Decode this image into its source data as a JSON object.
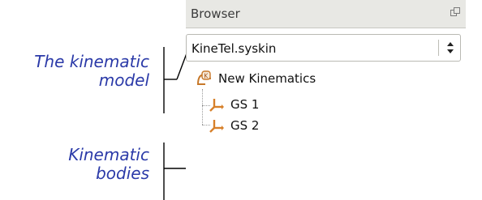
{
  "annotations": {
    "model": [
      "The kinematic",
      "model"
    ],
    "bodies": [
      "Kinematic",
      "bodies"
    ]
  },
  "panel": {
    "title": "Browser",
    "float_icon": "float-window-icon",
    "selector_value": "KineTel.syskin",
    "tree": {
      "root": {
        "label": "New Kinematics",
        "icon": "kinematics-root-icon"
      },
      "children": [
        {
          "label": "GS 1",
          "icon": "kinematic-body-icon"
        },
        {
          "label": "GS 2",
          "icon": "kinematic-body-icon"
        }
      ]
    }
  },
  "colors": {
    "annotation_text": "#2b3aa8",
    "icon_orange": "#d7802a",
    "titlebar_bg": "#e8e8e4"
  }
}
